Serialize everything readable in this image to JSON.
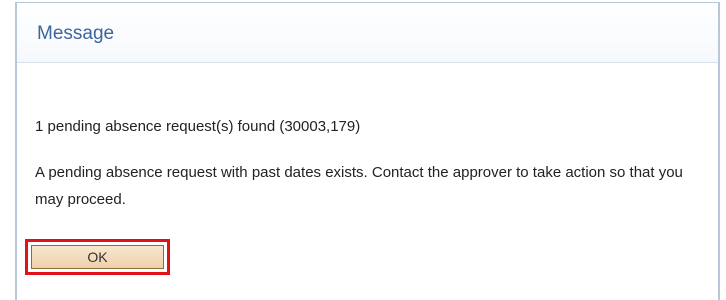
{
  "dialog": {
    "title": "Message",
    "message_header": "1 pending absence request(s) found (30003,179)",
    "message_body": "A pending absence request with past dates exists. Contact the approver to take action so that you may proceed.",
    "ok_label": "OK"
  },
  "colors": {
    "title": "#3b669e",
    "dialog_border": "#b9c7d8",
    "button_fill": "#f0d3ad",
    "button_border": "#8f6b3a",
    "highlight": "#e0111a",
    "text": "#222222"
  }
}
